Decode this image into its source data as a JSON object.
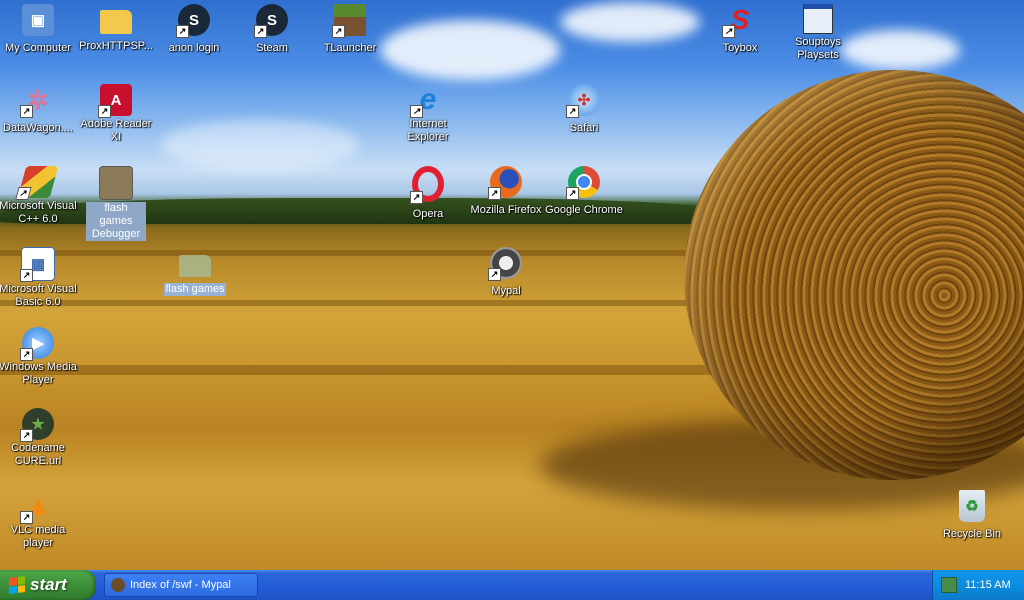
{
  "desktop": {
    "icons": [
      {
        "id": "my-computer",
        "label": "My Computer",
        "icon": "computer-icon",
        "shortcut": false,
        "color": "#5b8fd6",
        "glyph": "🖥"
      },
      {
        "id": "proxhttpsp",
        "label": "ProxHTTPSP...",
        "icon": "folder-icon",
        "shortcut": false,
        "color": "#f2c94c",
        "glyph": ""
      },
      {
        "id": "anon-login",
        "label": "anon login",
        "icon": "steam-icon",
        "shortcut": true,
        "color": "#1b2838",
        "glyph": "S"
      },
      {
        "id": "steam",
        "label": "Steam",
        "icon": "steam-icon",
        "shortcut": true,
        "color": "#1b2838",
        "glyph": "S"
      },
      {
        "id": "tlauncher",
        "label": "TLauncher",
        "icon": "minecraft-grass-block-icon",
        "shortcut": true,
        "color": "#5a8a2f",
        "glyph": ""
      },
      {
        "id": "toybox",
        "label": "Toybox",
        "icon": "toybox-s-logo-icon",
        "shortcut": true,
        "color": "#e02020",
        "glyph": "S"
      },
      {
        "id": "souptoys",
        "label": "Souptoys Playsets",
        "icon": "window-app-icon",
        "shortcut": false,
        "color": "#e8eef8",
        "glyph": ""
      },
      {
        "id": "datawagon",
        "label": "DataWagon....",
        "icon": "datawagon-icon",
        "shortcut": true,
        "color": "#d07aa0",
        "glyph": "✲"
      },
      {
        "id": "adobe-reader",
        "label": "Adobe Reader XI",
        "icon": "adobe-reader-icon",
        "shortcut": true,
        "color": "#c8102e",
        "glyph": "A"
      },
      {
        "id": "internet-explorer",
        "label": "Internet Explorer",
        "icon": "internet-explorer-icon",
        "shortcut": true,
        "color": "#1e7fd8",
        "glyph": "e"
      },
      {
        "id": "safari",
        "label": "Safari",
        "icon": "safari-compass-icon",
        "shortcut": true,
        "color": "#3a8ee6",
        "glyph": "✣"
      },
      {
        "id": "msvc",
        "label": "Microsoft Visual C++ 6.0",
        "icon": "visual-cpp-icon",
        "shortcut": true,
        "color": "#d9402b",
        "glyph": "◆"
      },
      {
        "id": "flash-debugger",
        "label": "flash games Debugger",
        "icon": "folder-icon",
        "shortcut": false,
        "color": "#b8a878",
        "glyph": ""
      },
      {
        "id": "opera",
        "label": "Opera",
        "icon": "opera-icon",
        "shortcut": true,
        "color": "#e02030",
        "glyph": "O"
      },
      {
        "id": "firefox",
        "label": "Mozilla Firefox",
        "icon": "firefox-icon",
        "shortcut": true,
        "color": "#e86a1c",
        "glyph": "🦊"
      },
      {
        "id": "chrome",
        "label": "Google Chrome",
        "icon": "chrome-icon",
        "shortcut": true,
        "color": "#dd4b39",
        "glyph": "◉"
      },
      {
        "id": "msvb",
        "label": "Microsoft Visual Basic 6.0",
        "icon": "visual-basic-icon",
        "shortcut": true,
        "color": "#3a6ab0",
        "glyph": "▦"
      },
      {
        "id": "flash-games",
        "label": "flash games",
        "icon": "folder-icon",
        "shortcut": false,
        "color": "#a8b890",
        "glyph": ""
      },
      {
        "id": "mypal",
        "label": "Mypal",
        "icon": "mypal-raccoon-icon",
        "shortcut": true,
        "color": "#555555",
        "glyph": "🦝"
      },
      {
        "id": "wmp",
        "label": "Windows Media Player",
        "icon": "windows-media-player-icon",
        "shortcut": true,
        "color": "#2a7be0",
        "glyph": "▶"
      },
      {
        "id": "codename-cure",
        "label": "Codename CURE.url",
        "icon": "codename-cure-icon",
        "shortcut": true,
        "color": "#2f3f2a",
        "glyph": "★"
      },
      {
        "id": "vlc",
        "label": "VLC media player",
        "icon": "vlc-cone-icon",
        "shortcut": true,
        "color": "#f28a10",
        "glyph": "▲"
      },
      {
        "id": "recycle-bin",
        "label": "Recycle Bin",
        "icon": "recycle-bin-icon",
        "shortcut": false,
        "color": "#cfd8e0",
        "glyph": "♻"
      }
    ]
  },
  "taskbar": {
    "start_label": "start",
    "task_label": "Index of /swf - Mypal",
    "task_icon": "mypal-raccoon-icon",
    "tray_icon": "network-icon",
    "clock": "11:15 AM"
  }
}
